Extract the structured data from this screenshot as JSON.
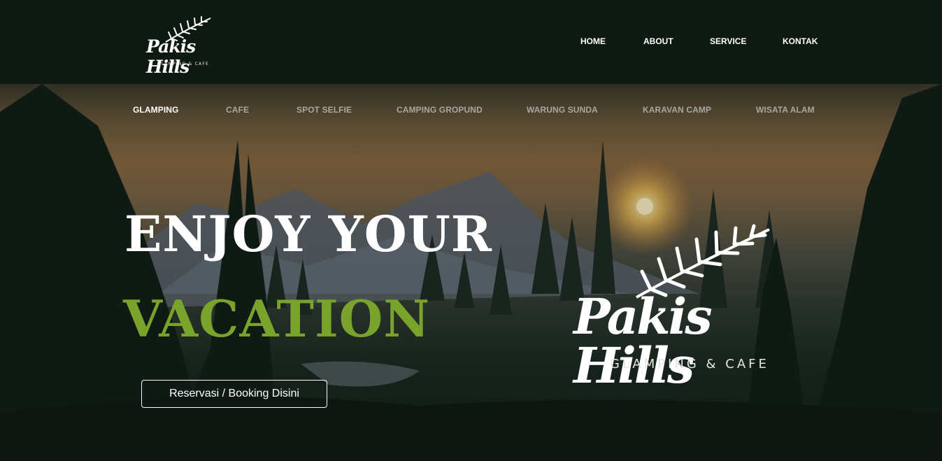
{
  "brand": {
    "logo_text": "Pakis Hills",
    "logo_subtitle": "GLAMPING & CAFE"
  },
  "main_nav": {
    "items": [
      {
        "label": "HOME"
      },
      {
        "label": "ABOUT"
      },
      {
        "label": "SERVICE"
      },
      {
        "label": "KONTAK"
      }
    ]
  },
  "sub_nav": {
    "items": [
      {
        "label": "GLAMPING",
        "active": true
      },
      {
        "label": "CAFE",
        "active": false
      },
      {
        "label": "SPOT SELFIE",
        "active": false
      },
      {
        "label": "CAMPING GROPUND",
        "active": false
      },
      {
        "label": "WARUNG SUNDA",
        "active": false
      },
      {
        "label": "KARAVAN CAMP",
        "active": false
      },
      {
        "label": "WISATA ALAM",
        "active": false
      }
    ]
  },
  "hero": {
    "headline_line1": "ENJOY YOUR",
    "headline_line2": "VACATION",
    "cta_label": "Reservasi / Booking Disini",
    "logo_text": "Pakis Hills",
    "logo_subtitle": "GLAMPING & CAFE"
  },
  "colors": {
    "header_bg": "#0e1a11",
    "accent_green": "#7aa32b",
    "inactive_link": "#a8a8a0"
  },
  "icons": [
    "fern-logo-icon"
  ]
}
